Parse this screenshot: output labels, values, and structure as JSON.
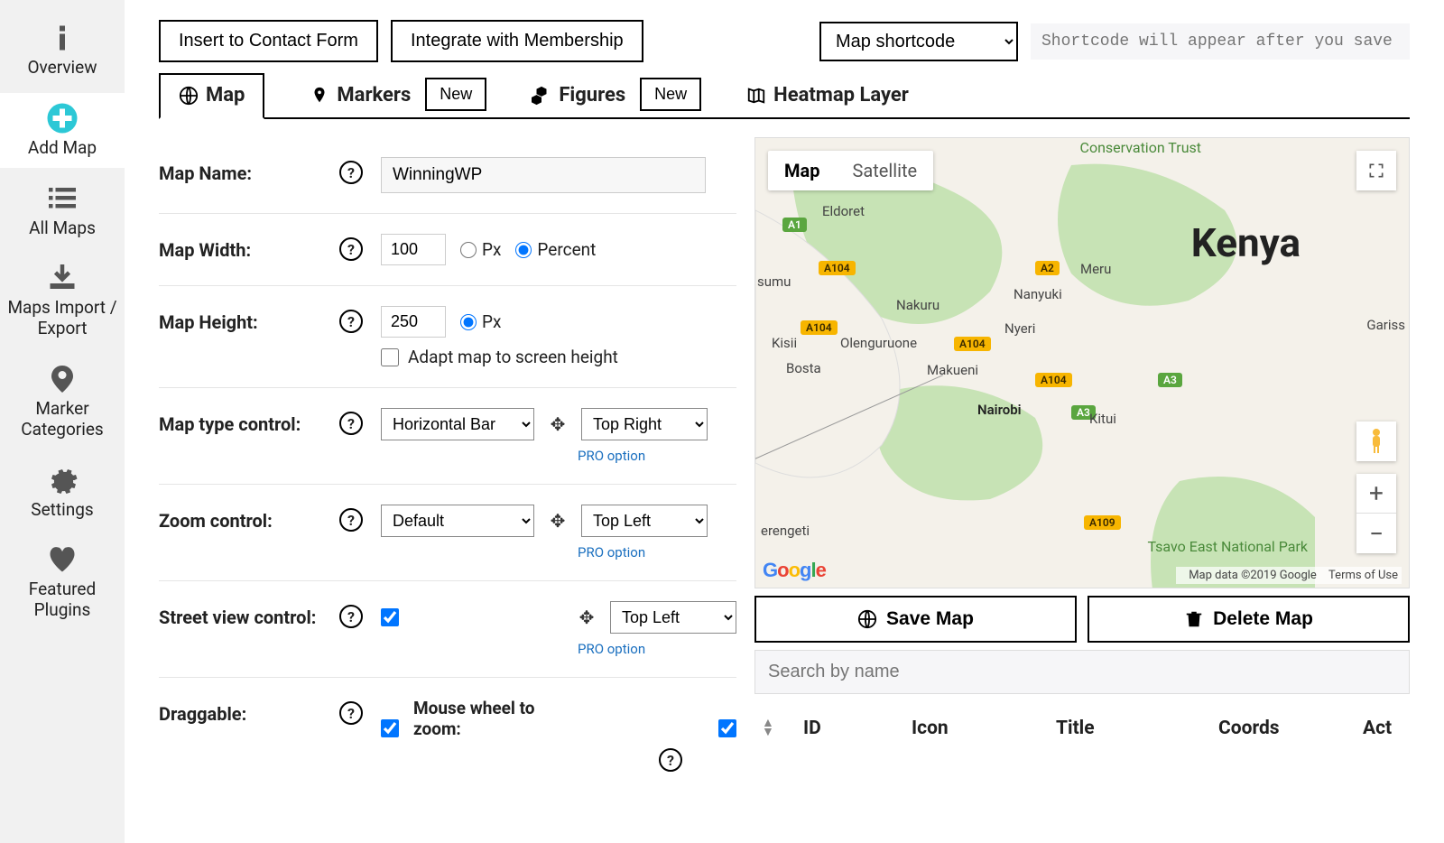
{
  "sidebar": {
    "items": [
      {
        "label": "Overview"
      },
      {
        "label": "Add Map"
      },
      {
        "label": "All Maps"
      },
      {
        "label": "Maps Import / Export"
      },
      {
        "label": "Marker Categories"
      },
      {
        "label": "Settings"
      },
      {
        "label": "Featured Plugins"
      }
    ]
  },
  "topbar": {
    "insert_contact": "Insert to Contact Form",
    "integrate_membership": "Integrate with Membership",
    "shortcode_select": "Map shortcode",
    "shortcode_placeholder": "Shortcode will appear after you save map"
  },
  "tabs": {
    "map": "Map",
    "markers": "Markers",
    "markers_new": "New",
    "figures": "Figures",
    "figures_new": "New",
    "heatmap": "Heatmap Layer"
  },
  "form": {
    "name_label": "Map Name:",
    "name_value": "WinningWP",
    "width_label": "Map Width:",
    "width_value": "100",
    "width_unit_px": "Px",
    "width_unit_pct": "Percent",
    "height_label": "Map Height:",
    "height_value": "250",
    "height_unit_px": "Px",
    "adapt_label": "Adapt map to screen height",
    "type_ctl_label": "Map type control:",
    "type_ctl_value": "Horizontal Bar",
    "type_ctl_pos": "Top Right",
    "zoom_ctl_label": "Zoom control:",
    "zoom_ctl_value": "Default",
    "zoom_ctl_pos": "Top Left",
    "street_ctl_label": "Street view control:",
    "street_ctl_pos": "Top Left",
    "draggable_label": "Draggable:",
    "wheel_zoom_label": "Mouse wheel to zoom:",
    "pro_option": "PRO option"
  },
  "map_preview": {
    "type_map": "Map",
    "type_satellite": "Satellite",
    "country": "Kenya",
    "cities": {
      "eldoret": "Eldoret",
      "sumu": "sumu",
      "nakuru": "Nakuru",
      "nanyuki": "Nanyuki",
      "meru": "Meru",
      "kisii": "Kisii",
      "olenguruone": "Olenguruone",
      "bosta": "Bosta",
      "nyeri": "Nyeri",
      "nairobi": "Nairobi",
      "makueni": "Makueni",
      "kitui": "Kitui",
      "garissa": "Gariss",
      "erengeti": "erengeti"
    },
    "roads": {
      "a1": "A1",
      "a104_1": "A104",
      "a2": "A2",
      "a104_2": "A104",
      "a104_3": "A104",
      "a104_4": "A104",
      "a3_1": "A3",
      "a3_2": "A3",
      "a109": "A109"
    },
    "cons_trust": "Conservation Trust",
    "tsavo": "Tsavo East National Park",
    "attrib_data": "Map data ©2019 Google",
    "attrib_terms": "Terms of Use"
  },
  "map_actions": {
    "save": "Save Map",
    "delete": "Delete Map"
  },
  "search": {
    "placeholder": "Search by name"
  },
  "table": {
    "headers": {
      "id": "ID",
      "icon": "Icon",
      "title": "Title",
      "coords": "Coords",
      "act": "Act"
    }
  }
}
